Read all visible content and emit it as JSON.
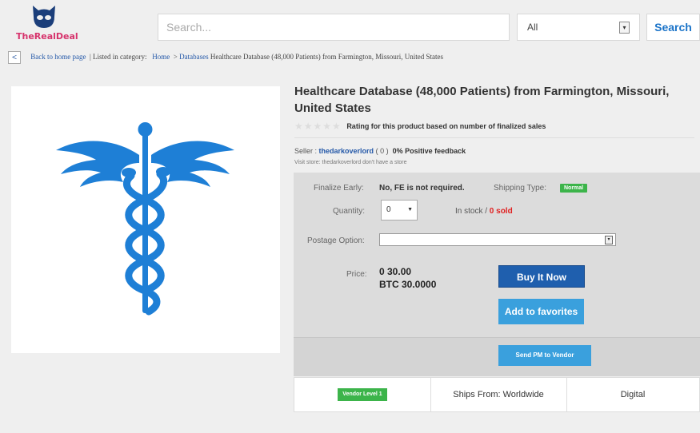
{
  "header": {
    "logo_text": "TheRealDeal",
    "search_placeholder": "Search...",
    "category_selected": "All",
    "search_button": "Search"
  },
  "breadcrumb": {
    "back_label": "Back to home page",
    "listed_label": "| Listed in category:",
    "home": "Home",
    "separator": ">",
    "category": "Databases",
    "current": "Healthcare Database (48,000 Patients) from Farmington, Missouri, United States"
  },
  "product": {
    "title": "Healthcare Database (48,000 Patients) from Farmington, Missouri, United States",
    "stars": "★★★★★",
    "rating_text": "Rating for this product based on number of finalized sales",
    "seller_label": "Seller :",
    "seller_name": "thedarkoverlord",
    "seller_count": "( 0 )",
    "positive_feedback": "0% Positive feedback",
    "visit_store": "Visit store:  thedarkoverlord don't have a store"
  },
  "details": {
    "finalize_label": "Finalize Early:",
    "finalize_value": "No, FE is not required.",
    "shipping_label": "Shipping Type:",
    "shipping_badge": "Normal",
    "quantity_label": "Quantity:",
    "quantity_value": "0",
    "stock_text": "In stock /",
    "sold_text": "0 sold",
    "postage_label": "Postage Option:",
    "price_label": "Price:",
    "price_value": "0 30.00",
    "price_btc": "BTC 30.0000",
    "buy_button": "Buy It Now",
    "favorites_button": "Add to favorites",
    "pm_button": "Send PM to Vendor"
  },
  "strip": {
    "vendor_level": "Vendor Level 1",
    "ships_from": "Ships From: Worldwide",
    "type": "Digital"
  },
  "colors": {
    "accent_blue": "#1f5fae",
    "light_blue": "#3aa0dd",
    "badge_green": "#3cb44a",
    "caduceus_blue": "#1e7fd6",
    "logo_pink": "#d6336c"
  }
}
